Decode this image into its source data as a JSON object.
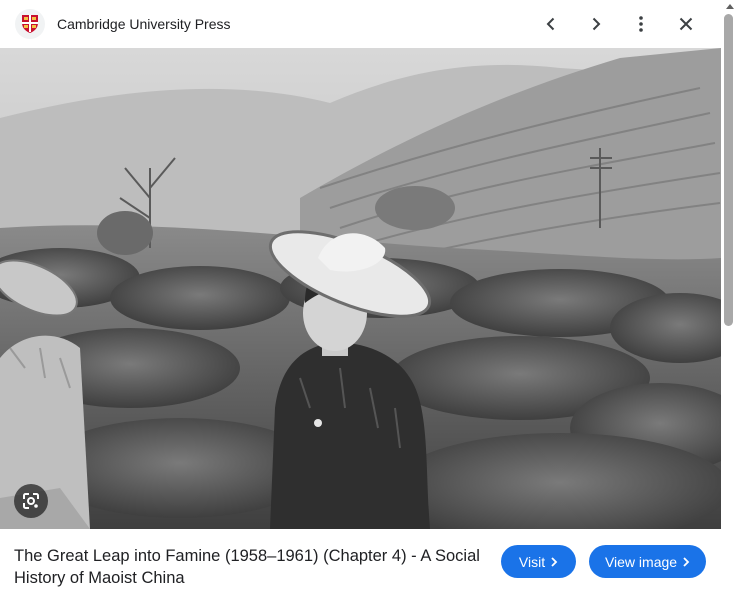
{
  "header": {
    "site_name": "Cambridge University Press",
    "logo_icon": "cambridge-shield-icon",
    "prev_icon": "chevron-left-icon",
    "next_icon": "chevron-right-icon",
    "menu_icon": "more-vert-icon",
    "close_icon": "close-icon"
  },
  "image": {
    "lens_icon": "google-lens-icon"
  },
  "footer": {
    "caption": "The Great Leap into Famine (1958–1961) (Chapter 4) - A Social History of Maoist China",
    "visit_label": "Visit",
    "view_image_label": "View image"
  },
  "colors": {
    "accent": "#1a73e8",
    "logo_red": "#c8102e",
    "text": "#202124"
  }
}
